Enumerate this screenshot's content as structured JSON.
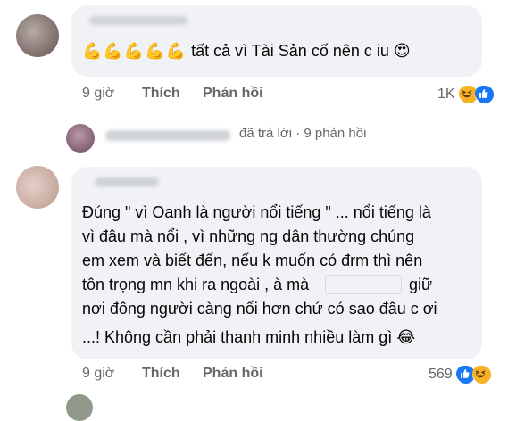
{
  "comment1": {
    "text": "tất cả vì Tài Sản cố nên c iu",
    "time": "9 giờ",
    "like_label": "Thích",
    "reply_label": "Phản hồi",
    "reaction_count": "1K",
    "emoji_prefix": "💪💪💪💪💪",
    "emoji_suffix": "😍"
  },
  "replies_bar": {
    "text": "đã trả lời · 9 phản hồi"
  },
  "comment2": {
    "lines": [
      "Đúng \" vì Oanh là người nổi tiếng \" ... nổi tiếng là",
      "vì đâu mà nổi , vì những ng dân thường chúng",
      "em xem và biết đến, nếu k muốn có đrm thì nên",
      "tôn trọng mn khi ra ngoài , à mà",
      "nơi đông người càng nổi hơn chứ có sao đâu c ơi",
      "...! Không cần phải thanh minh nhiều làm gì"
    ],
    "line4_end": "giữ",
    "time": "9 giờ",
    "like_label": "Thích",
    "reply_label": "Phản hồi",
    "reaction_count": "569",
    "emoji_suffix": "😂"
  },
  "colors": {
    "bubble": "#f0f2f5",
    "meta_text": "#65676b",
    "like_blue": "#1877f2",
    "haha_yellow": "#f7b125"
  }
}
